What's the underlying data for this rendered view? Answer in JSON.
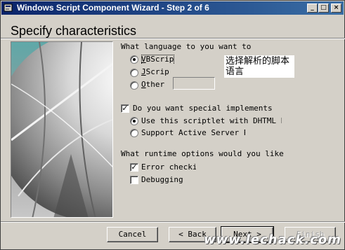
{
  "window": {
    "title": "Windows Script Component Wizard - Step 2 of 6",
    "controls": {
      "minimize": "_",
      "maximize": "□",
      "close": "×"
    }
  },
  "page_title": "Specify characteristics",
  "language_group": {
    "label": "What language to you want to",
    "options": [
      {
        "label": "VBScript",
        "underline": "V",
        "checked": true
      },
      {
        "label": "JScript",
        "underline": "J",
        "checked": false
      },
      {
        "label": "Other",
        "underline": "O",
        "checked": false
      }
    ],
    "other_value": ""
  },
  "annotation": "选择解析的脚本语言",
  "special_group": {
    "checkbox_label": "Do you want special implements su",
    "checked": true,
    "options": [
      {
        "label": "Use this scriptlet with DHTML beh",
        "checked": true
      },
      {
        "label": "Support Active Server Pa",
        "checked": false
      }
    ]
  },
  "runtime_group": {
    "label": "What runtime options would you like",
    "options": [
      {
        "label": "Error checkir",
        "checked": true
      },
      {
        "label": "Debugging",
        "checked": false
      }
    ]
  },
  "buttons": {
    "cancel": "Cancel",
    "back": "< Back",
    "next": "Next >",
    "finish": "Finish"
  },
  "watermark": "www.lechack.com"
}
